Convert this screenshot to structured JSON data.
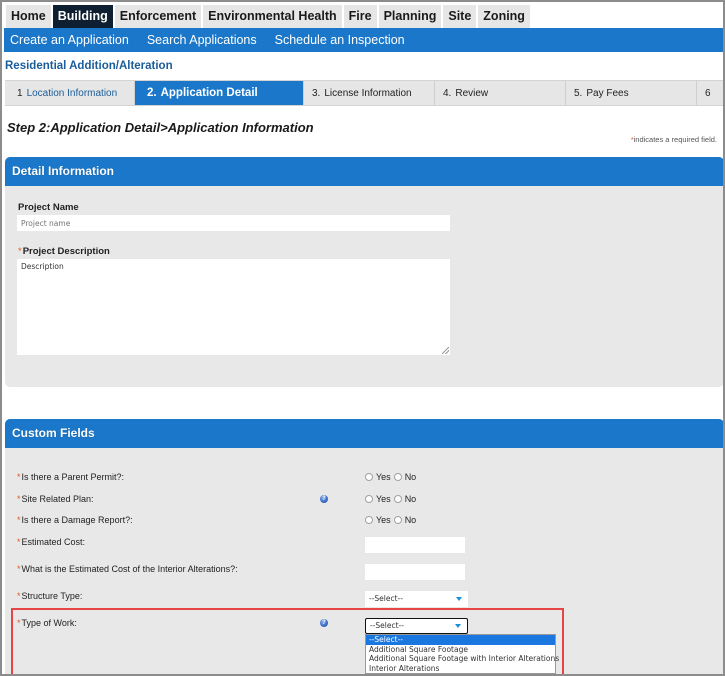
{
  "module_tabs": [
    {
      "label": "Home",
      "active": false
    },
    {
      "label": "Building",
      "active": true
    },
    {
      "label": "Enforcement",
      "active": false
    },
    {
      "label": "Environmental Health",
      "active": false
    },
    {
      "label": "Fire",
      "active": false
    },
    {
      "label": "Planning",
      "active": false
    },
    {
      "label": "Site",
      "active": false
    },
    {
      "label": "Zoning",
      "active": false
    }
  ],
  "subnav": [
    {
      "label": "Create an Application"
    },
    {
      "label": "Search Applications"
    },
    {
      "label": "Schedule an Inspection"
    }
  ],
  "record_type": "Residential Addition/Alteration",
  "steps": [
    {
      "num": "1",
      "label": "Location Information",
      "state": "done"
    },
    {
      "num": "2.",
      "label": "Application Detail",
      "state": "current"
    },
    {
      "num": "3.",
      "label": "License Information",
      "state": "pending"
    },
    {
      "num": "4.",
      "label": "Review",
      "state": "pending"
    },
    {
      "num": "5.",
      "label": "Pay Fees",
      "state": "pending"
    },
    {
      "num": "6",
      "label": "",
      "state": "pending"
    }
  ],
  "step_title": "Step 2:Application Detail>Application Information",
  "required_note": {
    "star": "*",
    "text": "indicates a required field."
  },
  "detail_panel": {
    "title": "Detail Information",
    "project_name": {
      "label": "Project Name",
      "placeholder": "Project name",
      "value": ""
    },
    "project_description": {
      "required": "*",
      "label": "Project Description",
      "placeholder": "Description",
      "value": ""
    }
  },
  "custom_panel": {
    "title": "Custom Fields",
    "radio_yes": "Yes",
    "radio_no": "No",
    "fields": [
      {
        "required": "*",
        "label": "Is there a Parent Permit?:",
        "type": "radio",
        "help": false
      },
      {
        "required": "*",
        "label": "Site Related Plan:",
        "type": "radio",
        "help": true
      },
      {
        "required": "*",
        "label": "Is there a Damage Report?:",
        "type": "radio",
        "help": false
      },
      {
        "required": "*",
        "label": "Estimated Cost:",
        "type": "text",
        "value": ""
      },
      {
        "required": "*",
        "label": "What is the Estimated Cost of the Interior Alterations?:",
        "type": "text",
        "value": ""
      },
      {
        "required": "*",
        "label": "Structure Type:",
        "type": "select",
        "value": "--Select--"
      },
      {
        "required": "*",
        "label": "Type of Work:",
        "type": "select",
        "value": "--Select--",
        "help": true
      }
    ],
    "type_of_work_options": [
      {
        "label": "--Select--",
        "selected": true
      },
      {
        "label": "Additional Square Footage",
        "selected": false
      },
      {
        "label": "Additional Square Footage with Interior Alterations",
        "selected": false
      },
      {
        "label": "Interior Alterations",
        "selected": false
      }
    ]
  },
  "help_icon_glyph": "?",
  "colors": {
    "brand_blue": "#1a77c9",
    "active_module_tab": "#0d1f30",
    "required_star": "#e05a1e",
    "highlight_border": "#e64545",
    "panel_bg": "#e8e8e8"
  }
}
